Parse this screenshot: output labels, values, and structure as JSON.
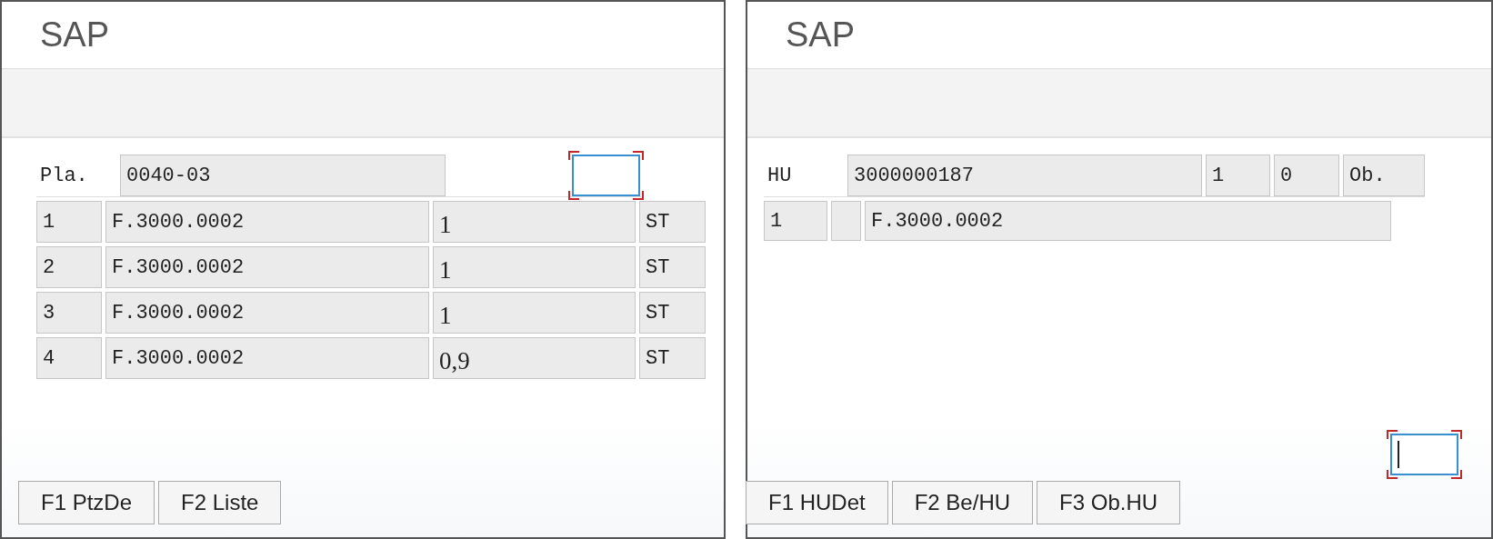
{
  "panels": [
    {
      "kind": "stock_list",
      "title": "SAP",
      "header": {
        "label": "Pla.",
        "values": [
          "0040-03"
        ]
      },
      "command_field": {
        "cursor": false
      },
      "rows": [
        {
          "cells": [
            "1",
            "F.3000.0002",
            "1",
            "ST"
          ]
        },
        {
          "cells": [
            "2",
            "F.3000.0002",
            "1",
            "ST"
          ]
        },
        {
          "cells": [
            "3",
            "F.3000.0002",
            "1",
            "ST"
          ]
        },
        {
          "cells": [
            "4",
            "F.3000.0002",
            "0,9",
            "ST"
          ]
        }
      ],
      "buttons": [
        "F1 PtzDe",
        "F2 Liste"
      ]
    },
    {
      "kind": "hu_detail",
      "title": "SAP",
      "header": {
        "label": "HU",
        "values": [
          "3000000187",
          "1",
          "0",
          "Ob."
        ]
      },
      "command_field": {
        "cursor": true
      },
      "rows": [
        {
          "cells": [
            "1",
            "F.3000.0002"
          ]
        }
      ],
      "buttons": [
        "F1 HUDet",
        "F2 Be/HU",
        "F3 Ob.HU"
      ]
    }
  ]
}
